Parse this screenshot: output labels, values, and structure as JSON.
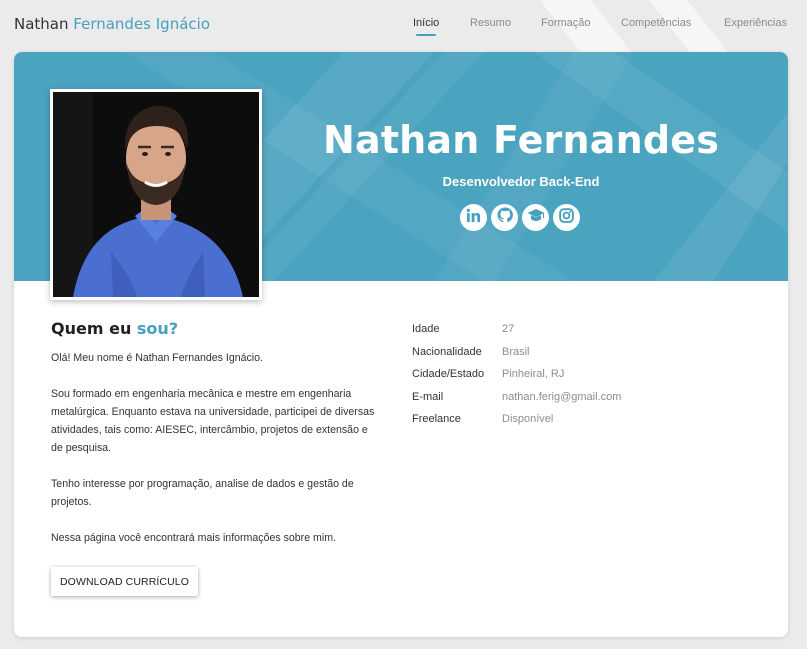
{
  "brand": {
    "first": "Nathan",
    "rest": "Fernandes Ignácio"
  },
  "nav": {
    "items": [
      {
        "label": "Início"
      },
      {
        "label": "Resumo"
      },
      {
        "label": "Formação"
      },
      {
        "label": "Competências"
      },
      {
        "label": "Experiências"
      }
    ],
    "active": "Início"
  },
  "hero": {
    "name": "Nathan Fernandes",
    "role": "Desenvolvedor Back-End",
    "socials": [
      "linkedin-icon",
      "github-icon",
      "graduation-cap-icon",
      "instagram-icon"
    ]
  },
  "about": {
    "title_start": "Quem eu",
    "title_accent": "sou?",
    "paragraphs": [
      "Olá! Meu nome é Nathan Fernandes Ignácio.",
      "Sou formado em engenharia mecânica e mestre em engenharia metalúrgica. Enquanto estava na universidade, participei de diversas atividades, tais como: AIESEC, intercâmbio, projetos de extensão e de pesquisa.",
      "Tenho interesse por programação, analise de dados e gestão de projetos.",
      "Nessa página você encontrará mais informações sobre mim."
    ],
    "download_label": "DOWNLOAD CURRÍCULO"
  },
  "info": [
    {
      "label": "Idade",
      "value": "27"
    },
    {
      "label": "Nacionalidade",
      "value": "Brasil"
    },
    {
      "label": "Cidade/Estado",
      "value": "Pinheiral, RJ"
    },
    {
      "label": "E-mail",
      "value": "nathan.ferig@gmail.com"
    },
    {
      "label": "Freelance",
      "value": "Disponível"
    }
  ],
  "colors": {
    "accent": "#45a1bf",
    "hero_bg": "#4aa3bf"
  }
}
